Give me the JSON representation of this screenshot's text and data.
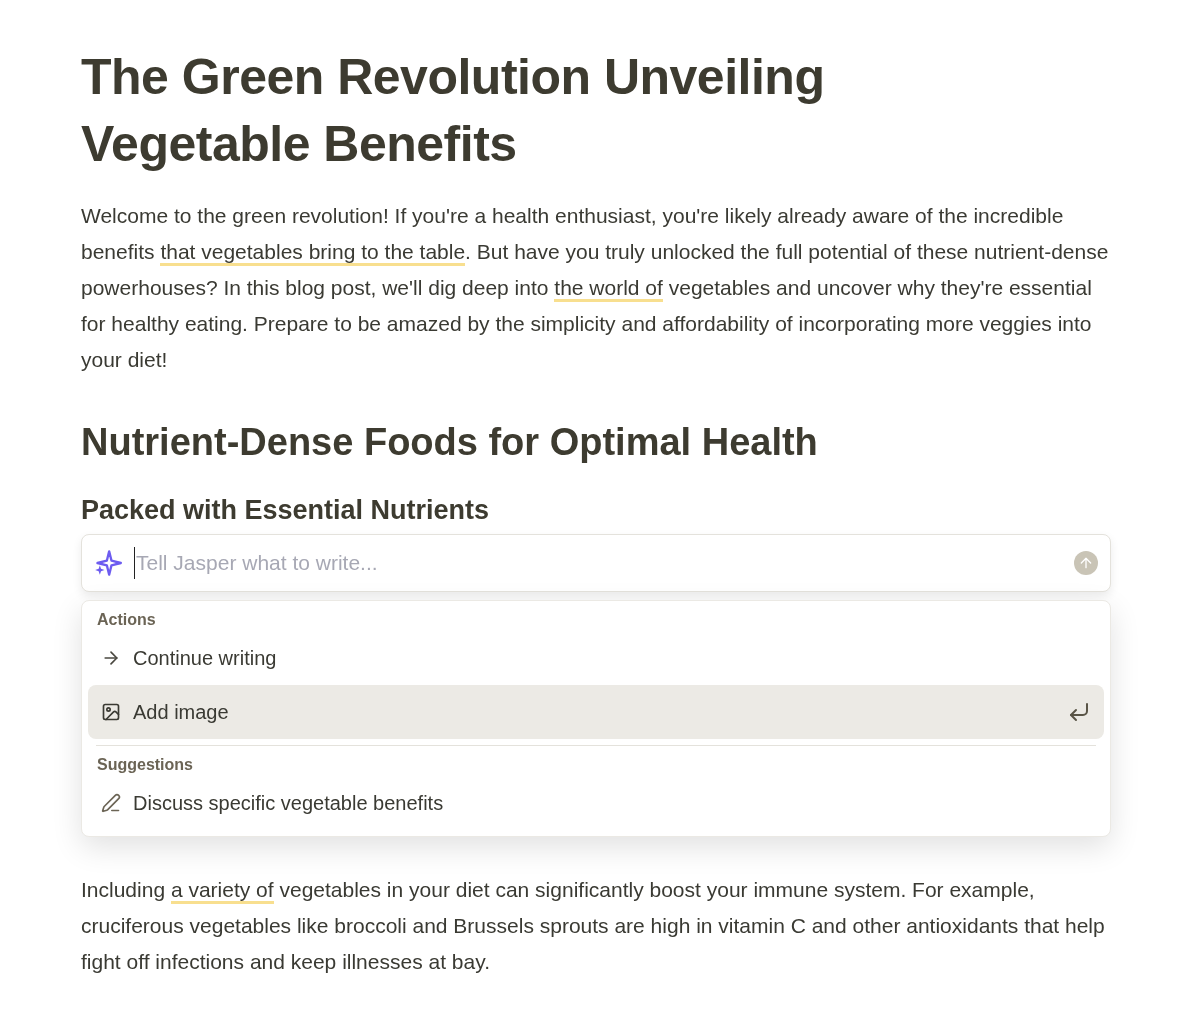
{
  "title": "The Green Revolution Unveiling Vegetable Benefits",
  "intro": [
    {
      "text": "Welcome to the green revolution! If you're a health enthusiast, you're likely already aware of the incredible benefits ",
      "underlined": false
    },
    {
      "text": "that vegetables bring to the table",
      "underlined": true
    },
    {
      "text": ". But have you truly unlocked the full potential of these nutrient-dense powerhouses? In this blog post, we'll dig deep into ",
      "underlined": false
    },
    {
      "text": "the world of",
      "underlined": true
    },
    {
      "text": " vegetables and uncover why they're essential for healthy eating. Prepare to be amazed by the simplicity and affordability of incorporating more veggies into your diet!",
      "underlined": false
    }
  ],
  "section_heading": "Nutrient-Dense Foods for Optimal Health",
  "subheading": "Packed with Essential Nutrients",
  "prompt": {
    "placeholder": "Tell Jasper what to write..."
  },
  "menu": [
    {
      "group": "Actions",
      "items": [
        {
          "kind": "arrow",
          "label": "Continue writing",
          "selected": false
        },
        {
          "kind": "image",
          "label": "Add image",
          "selected": true
        }
      ]
    },
    {
      "group": "Suggestions",
      "items": [
        {
          "kind": "pencil",
          "label": "Discuss specific vegetable benefits",
          "selected": false
        }
      ]
    }
  ],
  "paragraph_2": [
    {
      "text": "Including ",
      "underlined": false
    },
    {
      "text": "a variety of",
      "underlined": true
    },
    {
      "text": " vegetables in your diet can significantly boost your immune system. For example, cruciferous vegetables like broccoli and Brussels sprouts are high in vitamin C and other antioxidants that help fight off infections and keep illnesses at bay.",
      "underlined": false
    }
  ]
}
